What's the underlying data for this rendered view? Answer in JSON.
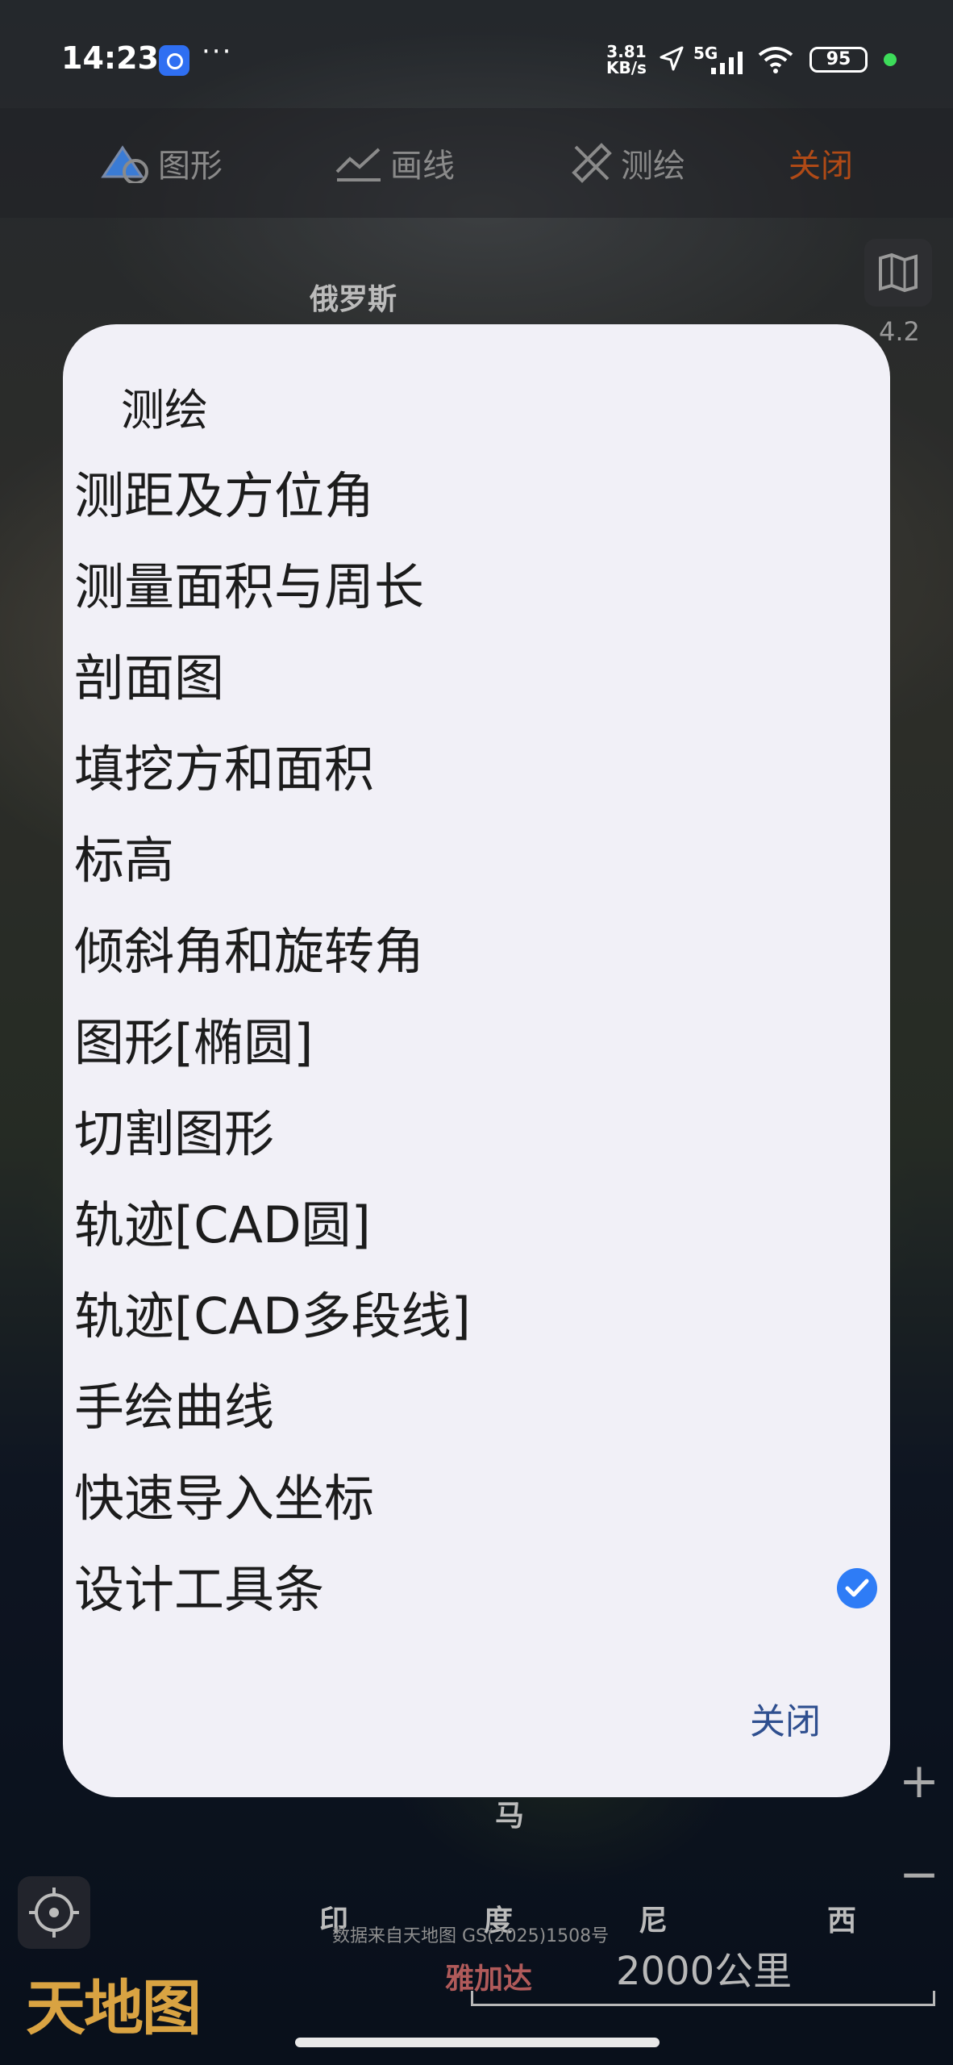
{
  "status_bar": {
    "time": "14:23",
    "more": "···",
    "net_speed_value": "3.81",
    "net_speed_unit": "KB/s",
    "network": "5G",
    "battery": "95"
  },
  "toolbar": {
    "shape_label": "图形",
    "line_label": "画线",
    "survey_label": "测绘",
    "close_label": "关闭"
  },
  "map": {
    "labels": {
      "russia": "俄罗斯",
      "malaysia_part": "马",
      "indonesia_parts": [
        "印",
        "度",
        "尼",
        "西"
      ],
      "jakarta": "雅加达"
    },
    "zoom_level": "4.2",
    "data_source": "数据来自天地图 GS(2025)1508号",
    "scale": "2000公里",
    "logo": "天地图"
  },
  "dialog": {
    "title": "测绘",
    "items": [
      "测距及方位角",
      "测量面积与周长",
      "剖面图",
      "填挖方和面积",
      "标高",
      "倾斜角和旋转角",
      "图形[椭圆]",
      "切割图形",
      "轨迹[CAD圆]",
      "轨迹[CAD多段线]",
      "手绘曲线",
      "快速导入坐标",
      "设计工具条"
    ],
    "checked_item": "设计工具条",
    "close_label": "关闭"
  },
  "colors": {
    "accent_check": "#2e7cf6",
    "close_button": "#2f4f8f",
    "toolbar_close": "#b04a16",
    "dialog_bg": "#f1f0f7"
  }
}
